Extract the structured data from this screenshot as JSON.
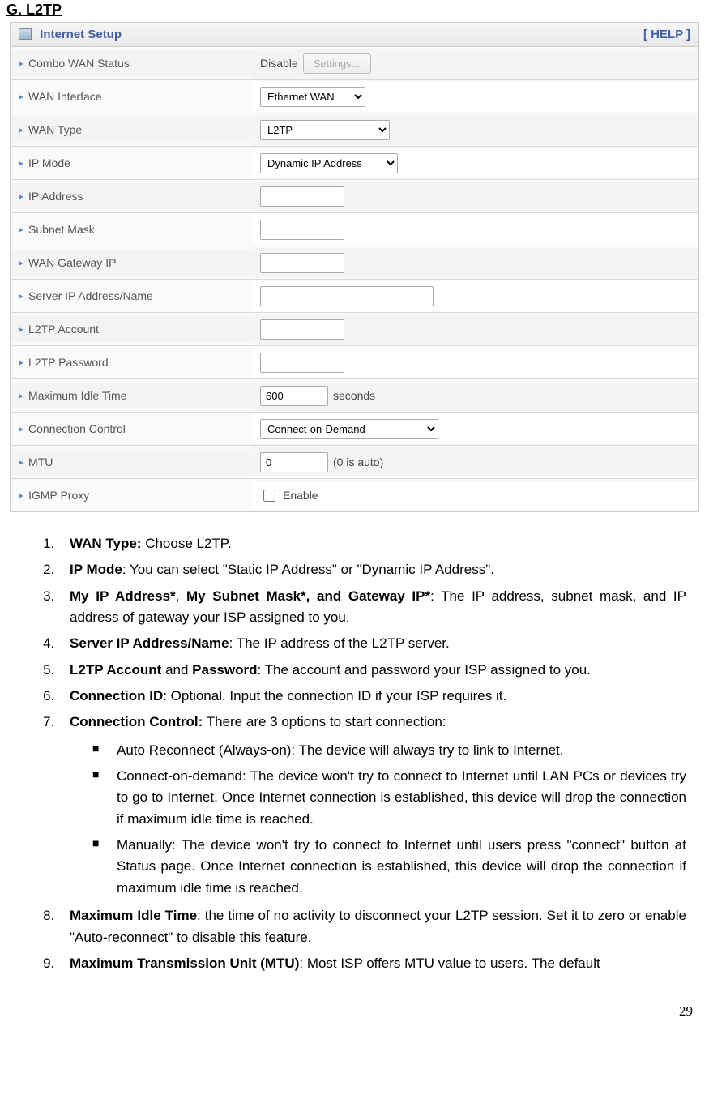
{
  "heading": "G. L2TP",
  "panel": {
    "title": "Internet Setup",
    "help": "[ HELP ]"
  },
  "rows": {
    "combo_wan": {
      "label": "Combo WAN Status",
      "value": "Disable",
      "button": "Settings..."
    },
    "wan_interface": {
      "label": "WAN Interface",
      "value": "Ethernet WAN"
    },
    "wan_type": {
      "label": "WAN Type",
      "value": "L2TP"
    },
    "ip_mode": {
      "label": "IP Mode",
      "value": "Dynamic IP Address"
    },
    "ip_address": {
      "label": "IP Address"
    },
    "subnet_mask": {
      "label": "Subnet Mask"
    },
    "wan_gateway": {
      "label": "WAN Gateway IP"
    },
    "server_ip": {
      "label": "Server IP Address/Name"
    },
    "l2tp_account": {
      "label": "L2TP Account"
    },
    "l2tp_password": {
      "label": "L2TP Password"
    },
    "max_idle": {
      "label": "Maximum Idle Time",
      "value": "600",
      "suffix": "seconds"
    },
    "conn_control": {
      "label": "Connection Control",
      "value": "Connect-on-Demand"
    },
    "mtu": {
      "label": "MTU",
      "value": "0",
      "suffix": "(0 is auto)"
    },
    "igmp": {
      "label": "IGMP Proxy",
      "checkbox_label": "Enable"
    }
  },
  "list": {
    "i1_b": "WAN Type:",
    "i1_t": " Choose L2TP.",
    "i2_b": "IP Mode",
    "i2_t": ": You can select \"Static IP Address\" or \"Dynamic IP Address\".",
    "i3_b": "My IP Address*",
    "i3_m": ", ",
    "i3_b2": "My Subnet Mask*, and Gateway IP*",
    "i3_t": ": The IP address, subnet mask, and IP address of gateway your ISP assigned to you.",
    "i4_b": "Server IP Address/Name",
    "i4_t": ": The IP address of the L2TP server.",
    "i5_b": "L2TP Account",
    "i5_m": " and ",
    "i5_b2": "Password",
    "i5_t": ": The account and password your ISP assigned to you.",
    "i6_b": "Connection ID",
    "i6_t": ": Optional. Input the connection ID if your ISP requires it.",
    "i7_b": "Connection Control:",
    "i7_t": " There are 3 options to start connection:",
    "b1": "Auto Reconnect (Always-on): The device will always try to link to Internet.",
    "b2": "Connect-on-demand: The device won't try to connect to Internet until LAN PCs or devices try to go to Internet. Once Internet connection is established, this device will drop the connection if maximum idle time is reached.",
    "b3": "Manually: The device won't try to connect to Internet until users press \"connect\" button at Status page. Once Internet connection is established, this device will drop the connection if maximum idle time is reached.",
    "i8_b": "Maximum Idle Time",
    "i8_t": ": the time of no activity to disconnect your L2TP session. Set it to zero or enable \"Auto-reconnect\" to disable this feature.",
    "i9_b": "Maximum Transmission Unit (MTU)",
    "i9_t": ": Most ISP offers MTU value to users. The default"
  },
  "page_number": "29"
}
